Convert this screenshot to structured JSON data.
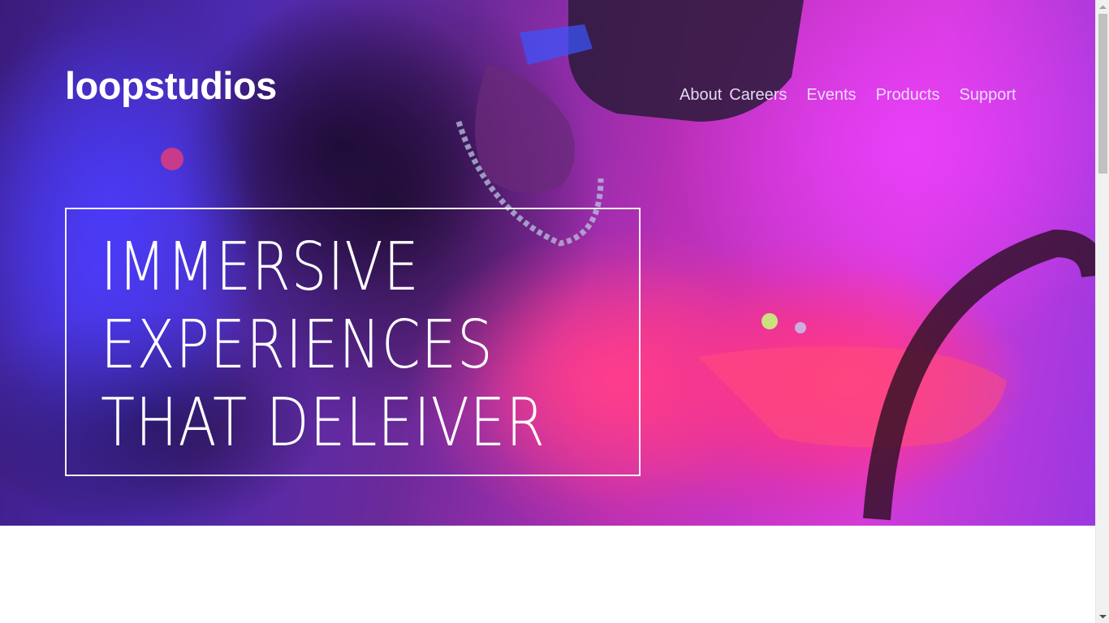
{
  "header": {
    "logo": "loopstudios",
    "nav": [
      "About",
      "Careers",
      "Events",
      "Products",
      "Support"
    ]
  },
  "hero": {
    "headline_lines": [
      "IMMERSIVE",
      "EXPERIENCES",
      "THAT DELEIVER"
    ]
  },
  "colors": {
    "hero_overlay_magenta": "#d43bd8",
    "hero_overlay_blue": "#4b2ab0",
    "text": "#ffffff",
    "scrollbar_track": "#f1f1f1",
    "scrollbar_thumb": "#c1c1c1"
  },
  "scrollbar": {
    "position_fraction": 0.0
  }
}
